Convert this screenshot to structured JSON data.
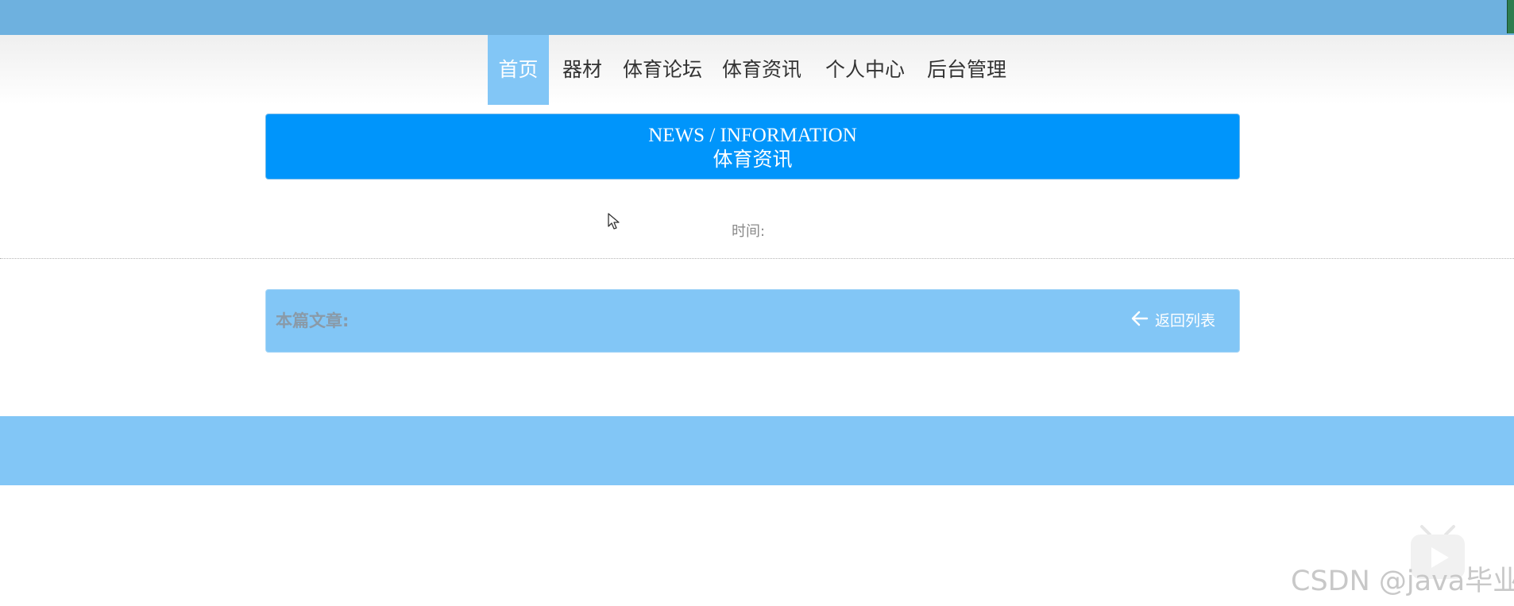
{
  "nav": {
    "items": [
      {
        "label": "首页",
        "active": true
      },
      {
        "label": "器材"
      },
      {
        "label": "体育论坛"
      },
      {
        "label": "体育资讯"
      },
      {
        "label": "个人中心"
      },
      {
        "label": "后台管理"
      }
    ]
  },
  "banner": {
    "title_en": "NEWS / INFORMATION",
    "title_cn": "体育资讯"
  },
  "article": {
    "time_label": "时间:",
    "this_article_label": "本篇文章:",
    "back_label": "返回列表"
  },
  "watermark": "CSDN @java毕业",
  "colors": {
    "topbar": "#6eb1df",
    "nav_active": "#82c6f6",
    "banner": "#0095fb",
    "article_bar": "#82c6f6",
    "footer": "#82c6f6"
  },
  "icons": [
    "left-arrow-icon",
    "cursor-icon",
    "play-icon"
  ]
}
